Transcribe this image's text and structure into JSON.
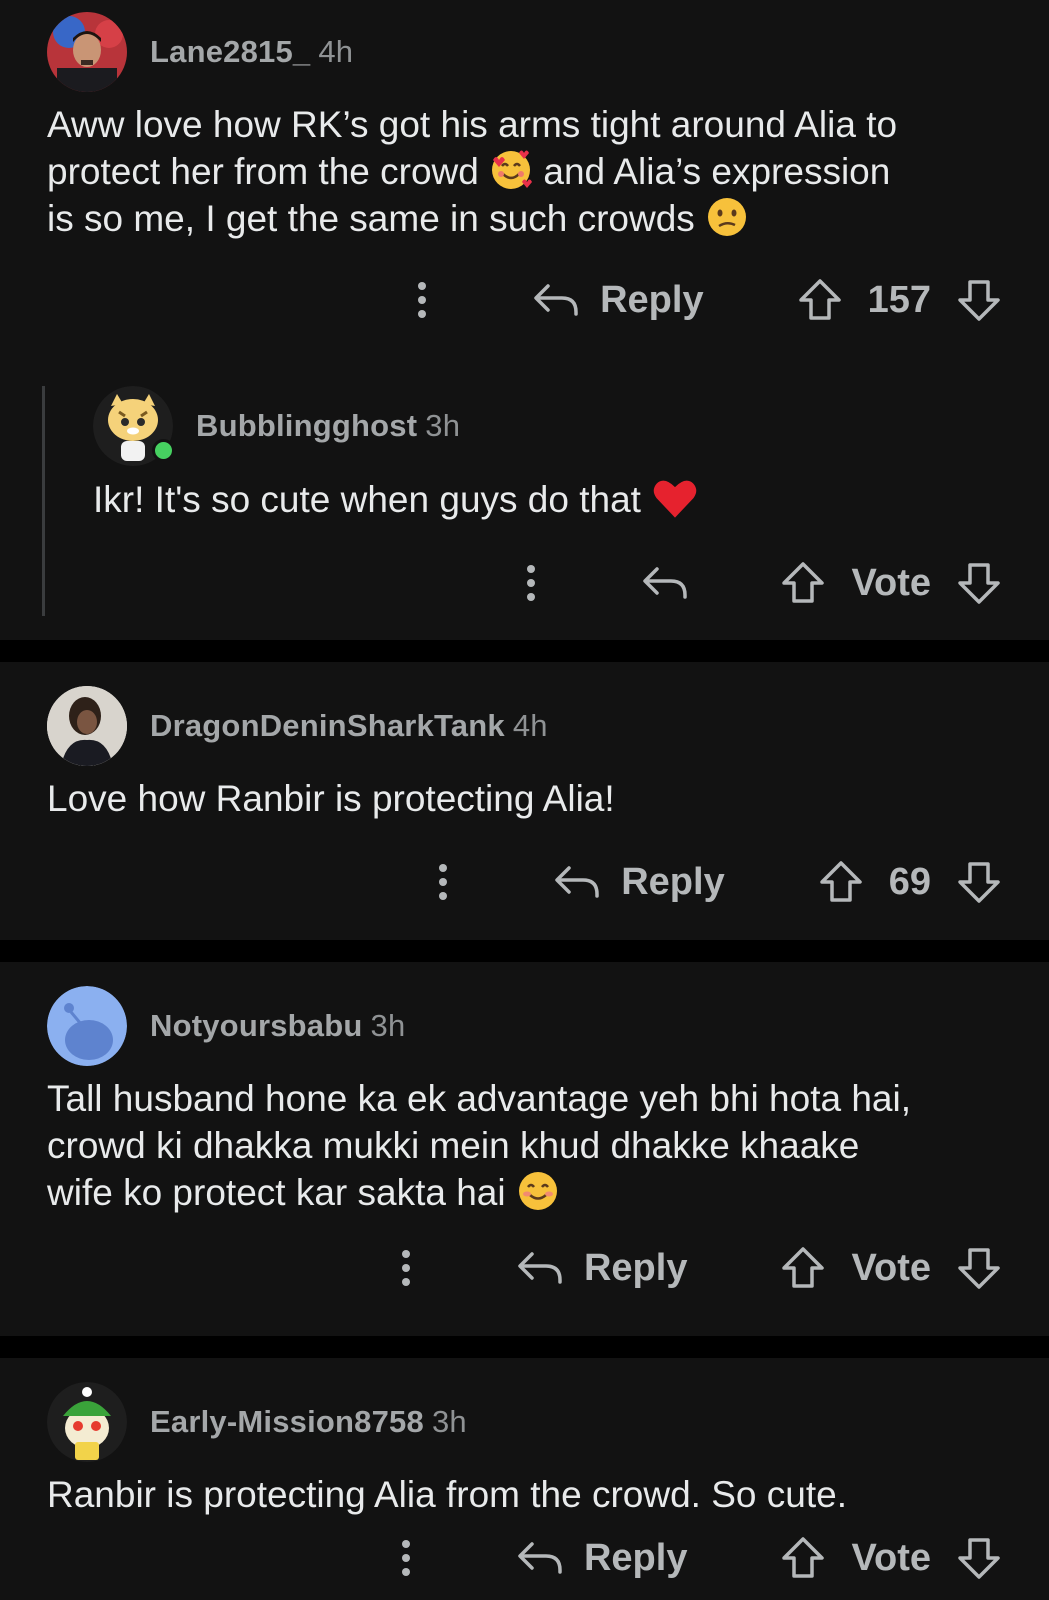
{
  "comments": [
    {
      "author": "Lane2815_",
      "time": "4h",
      "text_lines": [
        "Aww love how RK’s got his arms tight around Alia to",
        "protect her from the crowd",
        "and Alia’s expression",
        "is so me, I get the same in such crowds"
      ],
      "reply_label": "Reply",
      "score": "157"
    },
    {
      "author": "Bubblingghost",
      "time": "3h",
      "text": "Ikr! It's so cute when guys do that",
      "vote_label": "Vote"
    },
    {
      "author": "DragonDeninSharkTank",
      "time": "4h",
      "text": "Love how Ranbir is protecting Alia!",
      "reply_label": "Reply",
      "score": "69"
    },
    {
      "author": "Notyoursbabu",
      "time": "3h",
      "text_lines": [
        "Tall husband hone ka ek advantage yeh bhi hota hai,",
        "crowd ki dhakka mukki mein khud dhakke khaake",
        "wife ko protect kar sakta hai"
      ],
      "reply_label": "Reply",
      "vote_label": "Vote"
    },
    {
      "author": "Early-Mission8758",
      "time": "3h",
      "text": "Ranbir is protecting Alia from the crowd. So cute.",
      "reply_label": "Reply",
      "vote_label": "Vote"
    }
  ],
  "colors": {
    "background": "#000000",
    "card": "#121212",
    "text": "#e8eaeb",
    "meta": "#a4a7a9",
    "online": "#46d160"
  },
  "icons": [
    "more-vertical-icon",
    "reply-arrow-icon",
    "upvote-arrow-icon",
    "downvote-arrow-icon",
    "smiling-hearts-emoji",
    "confused-face-emoji",
    "red-heart-emoji",
    "smiling-blush-emoji"
  ]
}
